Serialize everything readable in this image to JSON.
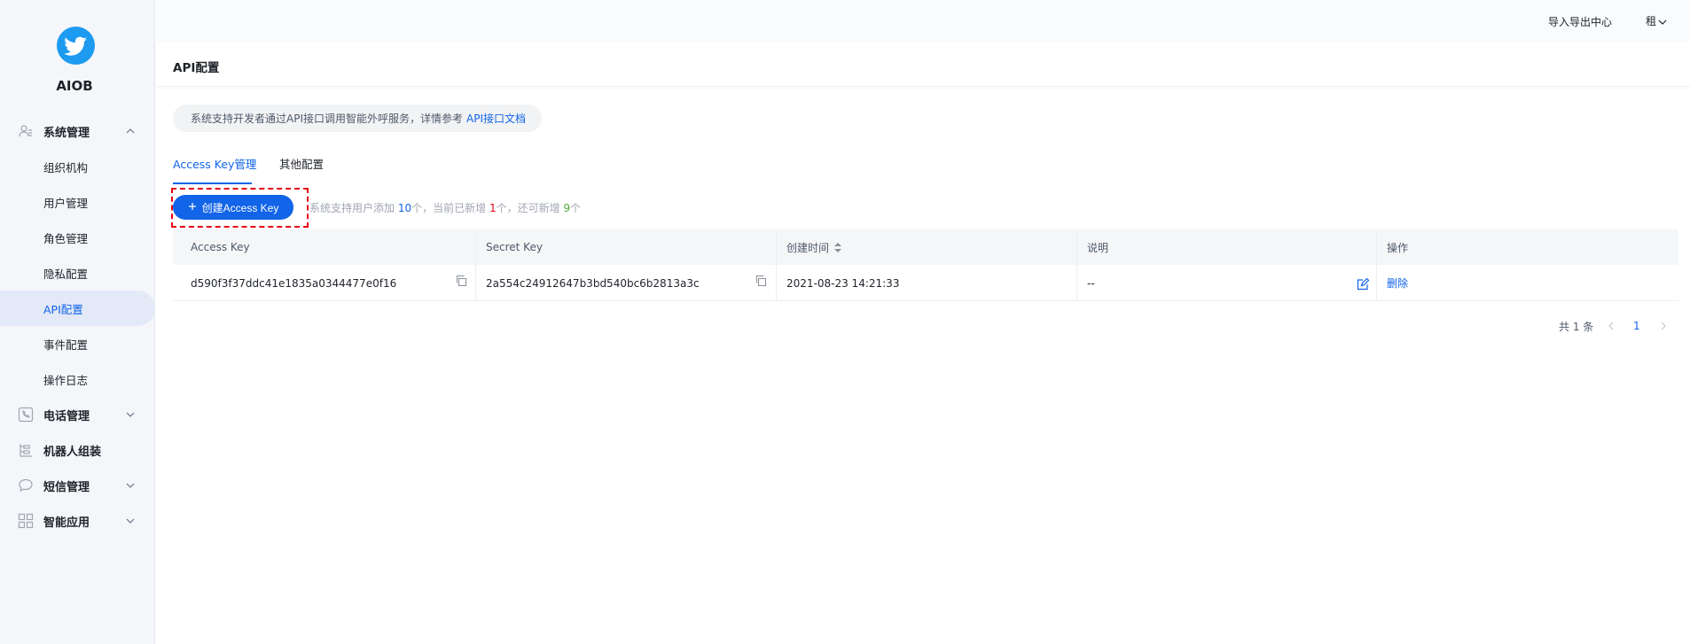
{
  "sidebar": {
    "brand": "AIOB",
    "groups": {
      "system": "系统管理",
      "phone": "电话管理",
      "robot": "机器人组装",
      "sms": "短信管理",
      "smart": "智能应用"
    },
    "items": {
      "org": "组织机构",
      "users": "用户管理",
      "roles": "角色管理",
      "privacy": "隐私配置",
      "api": "API配置",
      "events": "事件配置",
      "logs": "操作日志"
    }
  },
  "header": {
    "import_export": "导入导出中心",
    "user": "租"
  },
  "page": {
    "title": "API配置",
    "notice_text": "系统支持开发者通过API接口调用智能外呼服务，详情参考",
    "notice_link": "API接口文档"
  },
  "tabs": {
    "access_key": "Access Key管理",
    "other": "其他配置"
  },
  "create_button": "创建Access Key",
  "quota": {
    "p1": "系统支持用户添加 ",
    "max": "10",
    "p2": "个，当前已新增 ",
    "added": "1",
    "p3": "个，还可新增 ",
    "remaining": "9",
    "p4": "个"
  },
  "table": {
    "headers": {
      "access_key": "Access Key",
      "secret_key": "Secret Key",
      "created": "创建时间",
      "desc": "说明",
      "ops": "操作"
    },
    "rows": [
      {
        "access_key": "d590f3f37ddc41e1835a0344477e0f16",
        "secret_key": "2a554c24912647b3bd540bc6b2813a3c",
        "created": "2021-08-23 14:21:33",
        "desc": "--",
        "delete": "删除"
      }
    ]
  },
  "pagination": {
    "total": "共 1 条",
    "current": "1"
  },
  "colors": {
    "primary": "#1264e8",
    "highlight": "#e60012",
    "success": "#52a83a",
    "sidebar_bg": "#f4f6fa"
  }
}
